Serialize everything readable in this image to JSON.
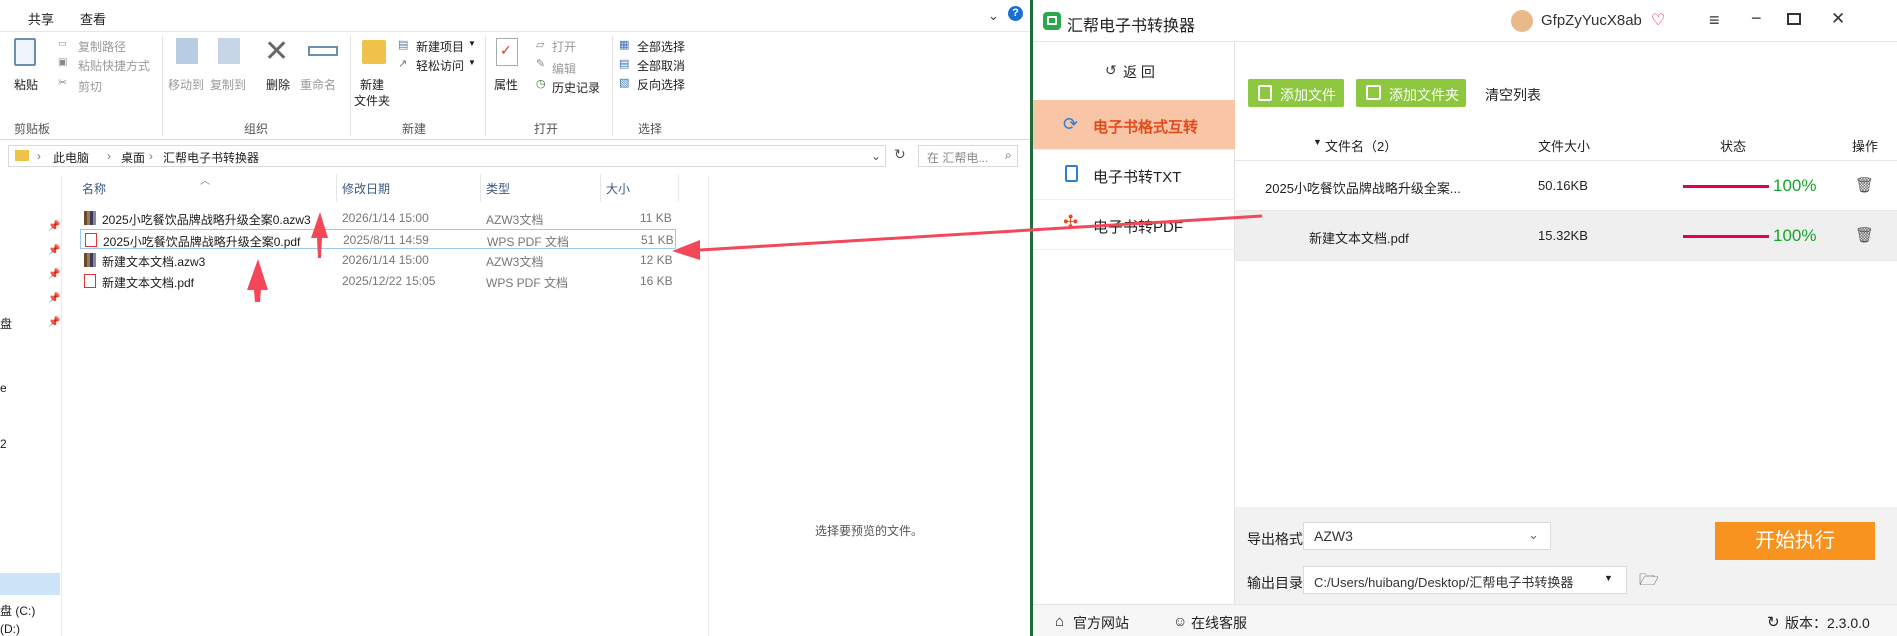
{
  "explorer": {
    "tabs": [
      "共享",
      "查看"
    ],
    "ribbon": {
      "clipboard": {
        "paste": "粘贴",
        "copy_path": "复制路径",
        "paste_shortcut": "粘贴快捷方式",
        "cut": "剪切",
        "group": "剪贴板"
      },
      "organize": {
        "move_to": "移动到",
        "copy_to": "复制到",
        "delete": "删除",
        "rename": "重命名",
        "group": "组织"
      },
      "new": {
        "new_folder_line1": "新建",
        "new_folder_line2": "文件夹",
        "new_item": "新建项目",
        "easy_access": "轻松访问",
        "group": "新建"
      },
      "open": {
        "properties": "属性",
        "open": "打开",
        "edit": "编辑",
        "history": "历史记录",
        "group": "打开"
      },
      "select": {
        "select_all": "全部选择",
        "select_none": "全部取消",
        "invert": "反向选择",
        "group": "选择"
      }
    },
    "address": {
      "crumbs": [
        "此电脑",
        "桌面",
        "汇帮电子书转换器"
      ]
    },
    "search_placeholder": "在 汇帮电...",
    "columns": {
      "name": "名称",
      "modified": "修改日期",
      "type": "类型",
      "size": "大小"
    },
    "files": [
      {
        "name": "2025小吃餐饮品牌战略升级全案0.azw3",
        "modified": "2026/1/14 15:00",
        "type": "AZW3文档",
        "size": "11 KB",
        "icon": "azw3-book-icon"
      },
      {
        "name": "2025小吃餐饮品牌战略升级全案0.pdf",
        "modified": "2025/8/11 14:59",
        "type": "WPS PDF 文档",
        "size": "51 KB",
        "icon": "pdf-file-icon",
        "selected": true
      },
      {
        "name": "新建文本文档.azw3",
        "modified": "2026/1/14 15:00",
        "type": "AZW3文档",
        "size": "12 KB",
        "icon": "azw3-book-icon"
      },
      {
        "name": "新建文本文档.pdf",
        "modified": "2025/12/22 15:05",
        "type": "WPS PDF 文档",
        "size": "16 KB",
        "icon": "pdf-file-icon"
      }
    ],
    "nav_fragments": [
      "盘",
      "e",
      "2",
      "盘 (C:)",
      "(D:)"
    ],
    "preview_text": "选择要预览的文件。"
  },
  "app": {
    "title": "汇帮电子书转换器",
    "user": "GfpZyYucX8ab",
    "sidebar": {
      "back": "返  回",
      "items": [
        {
          "label": "电子书格式互转",
          "active": true
        },
        {
          "label": "电子书转TXT"
        },
        {
          "label": "电子书转PDF"
        }
      ]
    },
    "toolbar": {
      "add_file": "添加文件",
      "add_folder": "添加文件夹",
      "clear_list": "清空列表"
    },
    "table": {
      "headers": {
        "name": "文件名（2）",
        "size": "文件大小",
        "status": "状态",
        "action": "操作"
      },
      "rows": [
        {
          "name": "2025小吃餐饮品牌战略升级全案...",
          "size": "50.16KB",
          "progress": "100%"
        },
        {
          "name": "新建文本文档.pdf",
          "size": "15.32KB",
          "progress": "100%"
        }
      ]
    },
    "export": {
      "format_label": "导出格式:",
      "format_value": "AZW3",
      "dir_label": "输出目录:",
      "dir_value": "C:/Users/huibang/Desktop/汇帮电子书转换器"
    },
    "start_button": "开始执行",
    "statusbar": {
      "website": "官方网站",
      "support": "在线客服",
      "version": "版本：2.3.0.0"
    },
    "colors": {
      "accent_orange": "#f7931e",
      "green_button": "#8dc63f",
      "active_tab_bg": "#f8c6a6",
      "progress_bar": "#e5004f",
      "progress_text": "#1aa22a"
    }
  }
}
